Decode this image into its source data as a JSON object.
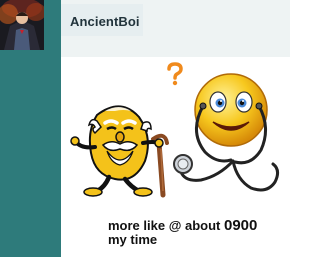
{
  "author": {
    "name": "AncientBoi"
  },
  "message": {
    "line1": "more like @ about",
    "time": "0900",
    "line2": "my time"
  },
  "emotes": {
    "question_mark": "?",
    "old_smiley": "old-man-smiley-with-cane",
    "doctor_smiley": "smiley-with-stethoscope"
  },
  "colors": {
    "sidebar_teal": "#2e7b7b",
    "card_bg": "#eef3f3",
    "content_bg": "#ffffff",
    "smiley_yellow": "#f4c21a",
    "question_orange": "#f08a1c"
  }
}
